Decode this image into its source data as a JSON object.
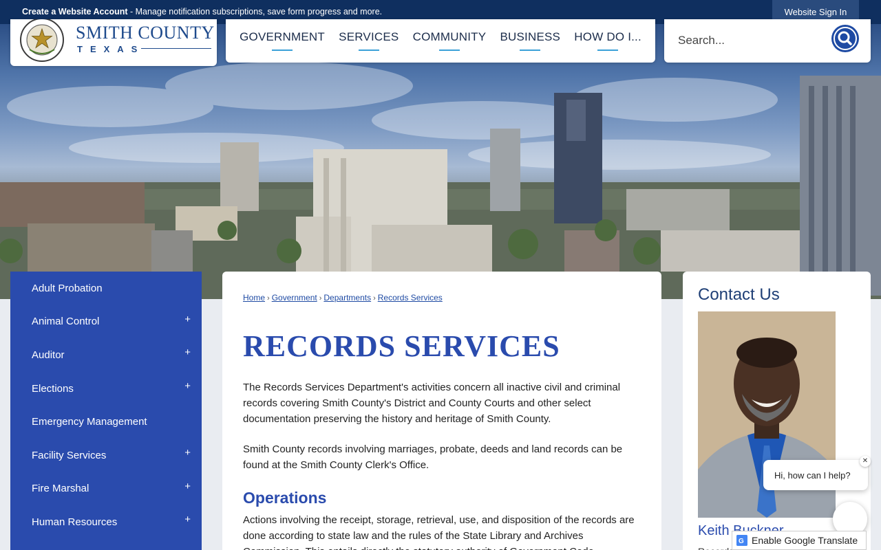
{
  "topbar": {
    "create_label": "Create a Website Account",
    "create_desc": " - Manage notification subscriptions, save form progress and more.",
    "signin_label": "Website Sign In"
  },
  "logo": {
    "title": "SMITH COUNTY",
    "subtitle": "TEXAS",
    "seal_ring_text": "THE COUNTY OF SMITH TEXAS"
  },
  "nav": {
    "items": [
      "GOVERNMENT",
      "SERVICES",
      "COMMUNITY",
      "BUSINESS",
      "HOW DO I..."
    ]
  },
  "search": {
    "placeholder": "Search...",
    "icon": "search-icon"
  },
  "sidebar": {
    "items": [
      {
        "label": "Adult Probation",
        "expandable": false
      },
      {
        "label": "Animal Control",
        "expandable": true
      },
      {
        "label": "Auditor",
        "expandable": true
      },
      {
        "label": "Elections",
        "expandable": true
      },
      {
        "label": "Emergency Management",
        "expandable": false
      },
      {
        "label": "Facility Services",
        "expandable": true
      },
      {
        "label": "Fire Marshal",
        "expandable": true
      },
      {
        "label": "Human Resources",
        "expandable": true
      }
    ],
    "toggle_symbol": "+"
  },
  "breadcrumb": {
    "items": [
      "Home",
      "Government",
      "Departments",
      "Records Services"
    ],
    "separator": "›"
  },
  "page": {
    "title": "RECORDS SERVICES",
    "paragraph1": "The Records Services Department's activities concern all inactive civil and criminal records covering Smith County's District and County Courts and other select documentation preserving the history and heritage of Smith County.",
    "paragraph2": "Smith County records involving marriages, probate, deeds and land records can be found at the Smith County Clerk's Office.",
    "operations_heading": "Operations",
    "paragraph3": "Actions involving the receipt, storage, retrieval, use, and disposition of the records are done according to state law and the rules of the State Library and Archives Commission. This entails directly the statutory authority of Government Code"
  },
  "contact": {
    "title": "Contact Us",
    "name": "Keith Buckner",
    "role": "Records"
  },
  "chat": {
    "message": "Hi, how can I help?",
    "close_symbol": "✕"
  },
  "translate": {
    "label": "Enable Google Translate"
  },
  "colors": {
    "topbar": "#0f2f5f",
    "brand_blue": "#2a4bad",
    "nav_underline": "#3aa0d8"
  }
}
